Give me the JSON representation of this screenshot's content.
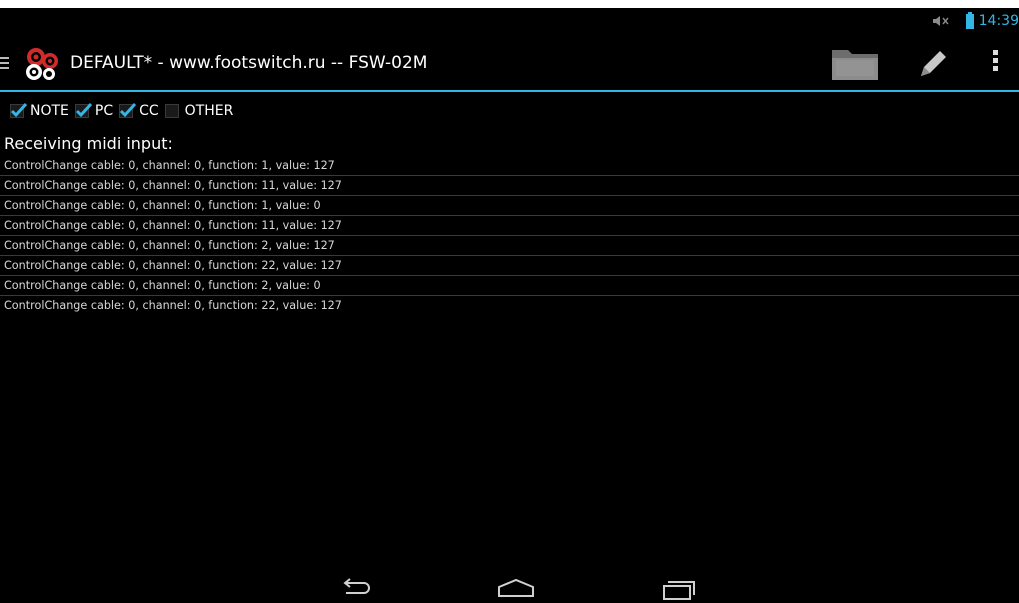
{
  "status_bar": {
    "time": "14:39",
    "icons": [
      "volume-muted-icon",
      "battery-icon"
    ],
    "accent_color": "#33b5e5"
  },
  "action_bar": {
    "title": "DEFAULT* - www.footswitch.ru -- FSW-02M",
    "logo_icon": "footswitch-logo-icon",
    "actions": [
      "folder-icon",
      "pencil-icon",
      "overflow-menu-icon"
    ]
  },
  "filters": [
    {
      "label": "NOTE",
      "checked": true
    },
    {
      "label": "PC",
      "checked": true
    },
    {
      "label": "CC",
      "checked": true
    },
    {
      "label": "OTHER",
      "checked": false
    }
  ],
  "main": {
    "heading": "Receiving midi input:",
    "log": [
      "ControlChange cable: 0, channel: 0, function: 1, value: 127",
      "ControlChange cable: 0, channel: 0, function: 11, value: 127",
      "ControlChange cable: 0, channel: 0, function: 1, value: 0",
      "ControlChange cable: 0, channel: 0, function: 11, value: 127",
      "ControlChange cable: 0, channel: 0, function: 2, value: 127",
      "ControlChange cable: 0, channel: 0, function: 22, value: 127",
      "ControlChange cable: 0, channel: 0, function: 2, value: 0",
      "ControlChange cable: 0, channel: 0, function: 22, value: 127"
    ]
  },
  "nav_bar": {
    "buttons": [
      "back-icon",
      "home-icon",
      "recent-apps-icon"
    ]
  }
}
